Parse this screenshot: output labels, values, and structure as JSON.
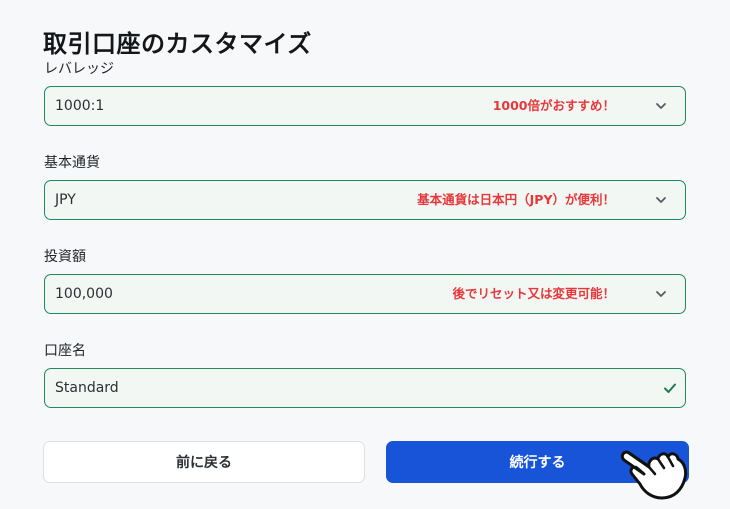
{
  "page": {
    "title": "取引口座のカスタマイズ"
  },
  "fields": {
    "leverage": {
      "label": "レバレッジ",
      "value": "1000:1",
      "note": "1000倍がおすすめ！"
    },
    "currency": {
      "label": "基本通貨",
      "value": "JPY",
      "note": "基本通貨は日本円（JPY）が便利！"
    },
    "investment": {
      "label": "投資額",
      "value": "100,000",
      "note": "後でリセット又は変更可能！"
    },
    "account_name": {
      "label": "口座名",
      "value": "Standard"
    }
  },
  "buttons": {
    "back_label": "前に戻る",
    "continue_label": "続行する"
  },
  "icons": {
    "dropdown": "chevron-down-icon",
    "valid": "check-icon",
    "pointer": "hand-pointer-icon"
  },
  "colors": {
    "accent_blue": "#1754d8",
    "field_border": "#1f8a5c",
    "note_red": "#e5383b"
  }
}
